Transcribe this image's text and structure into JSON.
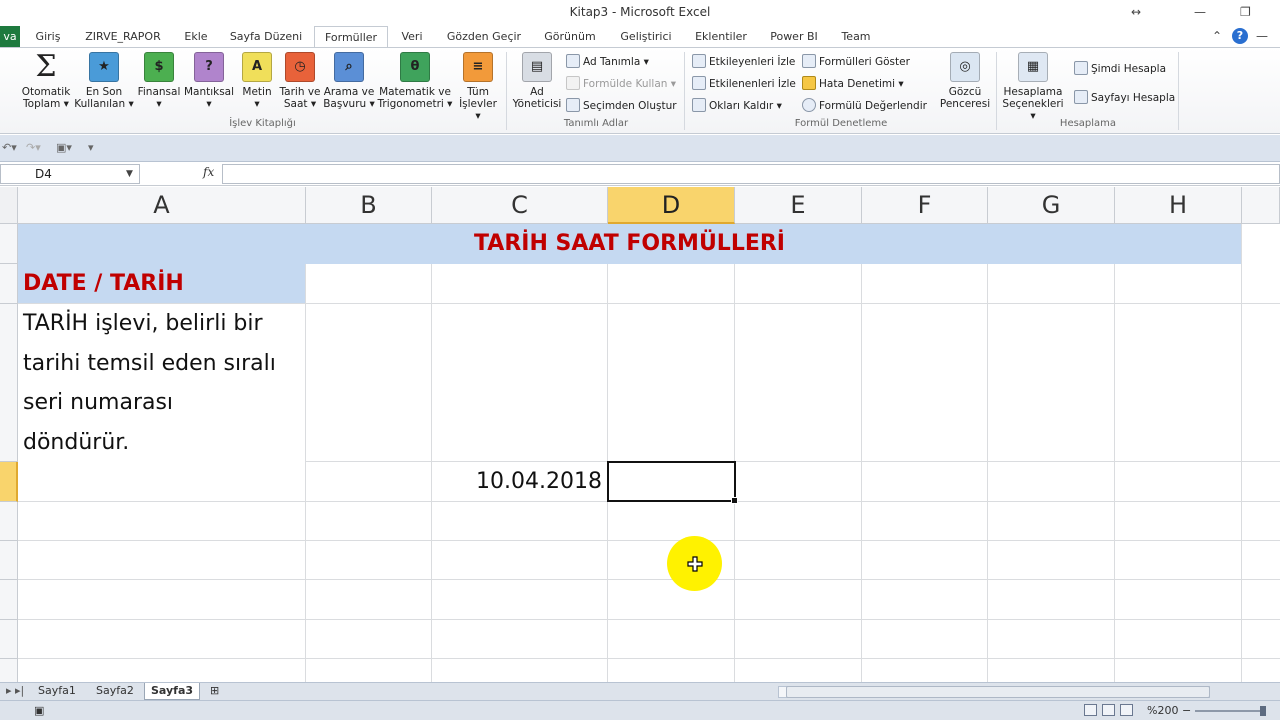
{
  "window": {
    "title": "Kitap3 - Microsoft Excel"
  },
  "ribbon_tabs": {
    "file": "va",
    "items": [
      "Giriş",
      "ZIRVE_RAPOR",
      "Ekle",
      "Sayfa Düzeni",
      "Formüller",
      "Veri",
      "Gözden Geçir",
      "Görünüm",
      "Geliştirici",
      "Eklentiler",
      "Power BI",
      "Team"
    ],
    "active": "Formüller"
  },
  "ribbon": {
    "function_library": {
      "autosum": {
        "line1": "Otomatik",
        "line2": "Toplam"
      },
      "recent": {
        "line1": "En Son",
        "line2": "Kullanılan"
      },
      "financial": "Finansal",
      "logical": "Mantıksal",
      "text": "Metin",
      "datetime": {
        "line1": "Tarih ve",
        "line2": "Saat"
      },
      "lookup": {
        "line1": "Arama ve",
        "line2": "Başvuru"
      },
      "math": {
        "line1": "Matematik ve",
        "line2": "Trigonometri"
      },
      "all": {
        "line1": "Tüm",
        "line2": "İşlevler"
      },
      "group_label": "İşlev Kitaplığı"
    },
    "defined_names": {
      "name_manager": {
        "line1": "Ad",
        "line2": "Yöneticisi"
      },
      "define_name": "Ad Tanımla",
      "use_in_formula": "Formülde Kullan",
      "create_from_selection": "Seçimden Oluştur",
      "group_label": "Tanımlı Adlar"
    },
    "auditing": {
      "trace_precedents": "Etkileyenleri İzle",
      "trace_dependents": "Etkilenenleri İzle",
      "remove_arrows": "Okları Kaldır",
      "show_formulas": "Formülleri Göster",
      "error_checking": "Hata Denetimi",
      "evaluate_formula": "Formülü Değerlendir",
      "watch_window": {
        "line1": "Gözcü",
        "line2": "Penceresi"
      },
      "group_label": "Formül Denetleme"
    },
    "calculation": {
      "options": {
        "line1": "Hesaplama",
        "line2": "Seçenekleri"
      },
      "calc_now": "Şimdi Hesapla",
      "calc_sheet": "Sayfayı Hesapla",
      "group_label": "Hesaplama"
    }
  },
  "formula_bar": {
    "name_box": "D4",
    "fx": "fx",
    "value": ""
  },
  "columns": [
    "A",
    "B",
    "C",
    "D",
    "E",
    "F",
    "G",
    "H"
  ],
  "selected_column": "D",
  "cells": {
    "title": "TARİH SAAT FORMÜLLERİ",
    "a_heading": "DATE / TARİH",
    "a_body": [
      "TARİH işlevi, belirli bir",
      "tarihi temsil eden sıralı",
      "seri numarası",
      "döndürür."
    ],
    "c4": "10.04.2018"
  },
  "sheets": {
    "items": [
      "Sayfa1",
      "Sayfa2",
      "Sayfa3"
    ],
    "active": "Sayfa3"
  },
  "status": {
    "zoom": "%200"
  },
  "colors": {
    "title_text": "#c00000",
    "header_fill": "#c5d9f1",
    "selection": "#f9d46c",
    "cursor_highlight": "#fff200"
  }
}
